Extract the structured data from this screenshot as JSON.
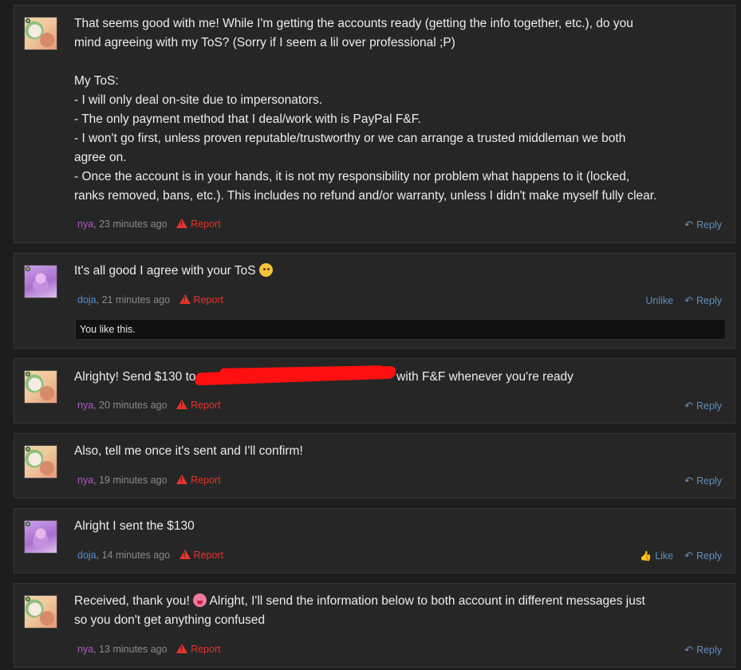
{
  "posts": [
    {
      "author": "nya",
      "time": "23 minutes ago",
      "report": "Report",
      "reply": "Reply",
      "lines": [
        "That seems good with me! While I'm getting the accounts ready (getting the info together, etc.), do you",
        "mind agreeing with my ToS? (Sorry if I seem a lil over professional ;P)",
        "",
        "My ToS:",
        "- I will only deal on-site due to impersonators.",
        "- The only payment method that I deal/work with is PayPal F&F.",
        "- I won't go first, unless proven reputable/trustworthy or we can arrange a trusted middleman we both",
        "agree on.",
        "- Once the account is in your hands, it is not my responsibility nor problem what happens to it (locked,",
        "ranks removed, bans, etc.). This includes no refund and/or warranty, unless I didn't make myself fully clear."
      ]
    },
    {
      "author": "doja",
      "time": "21 minutes ago",
      "report": "Report",
      "unlike": "Unlike",
      "reply": "Reply",
      "text": "It's all good I agree with your ToS",
      "emoji": "thinking-face-emoji",
      "liked_text": "You like this."
    },
    {
      "author": "nya",
      "time": "20 minutes ago",
      "report": "Report",
      "reply": "Reply",
      "text_before": "Alrighty! Send $130 to",
      "text_after": "with F&F whenever you're ready"
    },
    {
      "author": "nya",
      "time": "19 minutes ago",
      "report": "Report",
      "reply": "Reply",
      "text": "Also, tell me once it's sent and I'll confirm!"
    },
    {
      "author": "doja",
      "time": "14 minutes ago",
      "report": "Report",
      "like": "Like",
      "reply": "Reply",
      "text": "Alright I sent the $130"
    },
    {
      "author": "nya",
      "time": "13 minutes ago",
      "report": "Report",
      "reply": "Reply",
      "line1_before": "Received, thank you!",
      "line1_after": "Alright, I'll send the information below to both account in different messages just",
      "line2": "so you don't get anything confused",
      "emoji": "tongue-face-emoji"
    }
  ],
  "colors": {
    "page_background": "#1d1d1d",
    "post_background": "#262626",
    "nya_name": "#b05bc4",
    "doja_name": "#4a90d6",
    "report": "#e5332f",
    "action_link": "#5f8fbf",
    "redaction": "#ff1010"
  },
  "icons": [
    "warning-icon",
    "reply-icon",
    "like-icon"
  ]
}
